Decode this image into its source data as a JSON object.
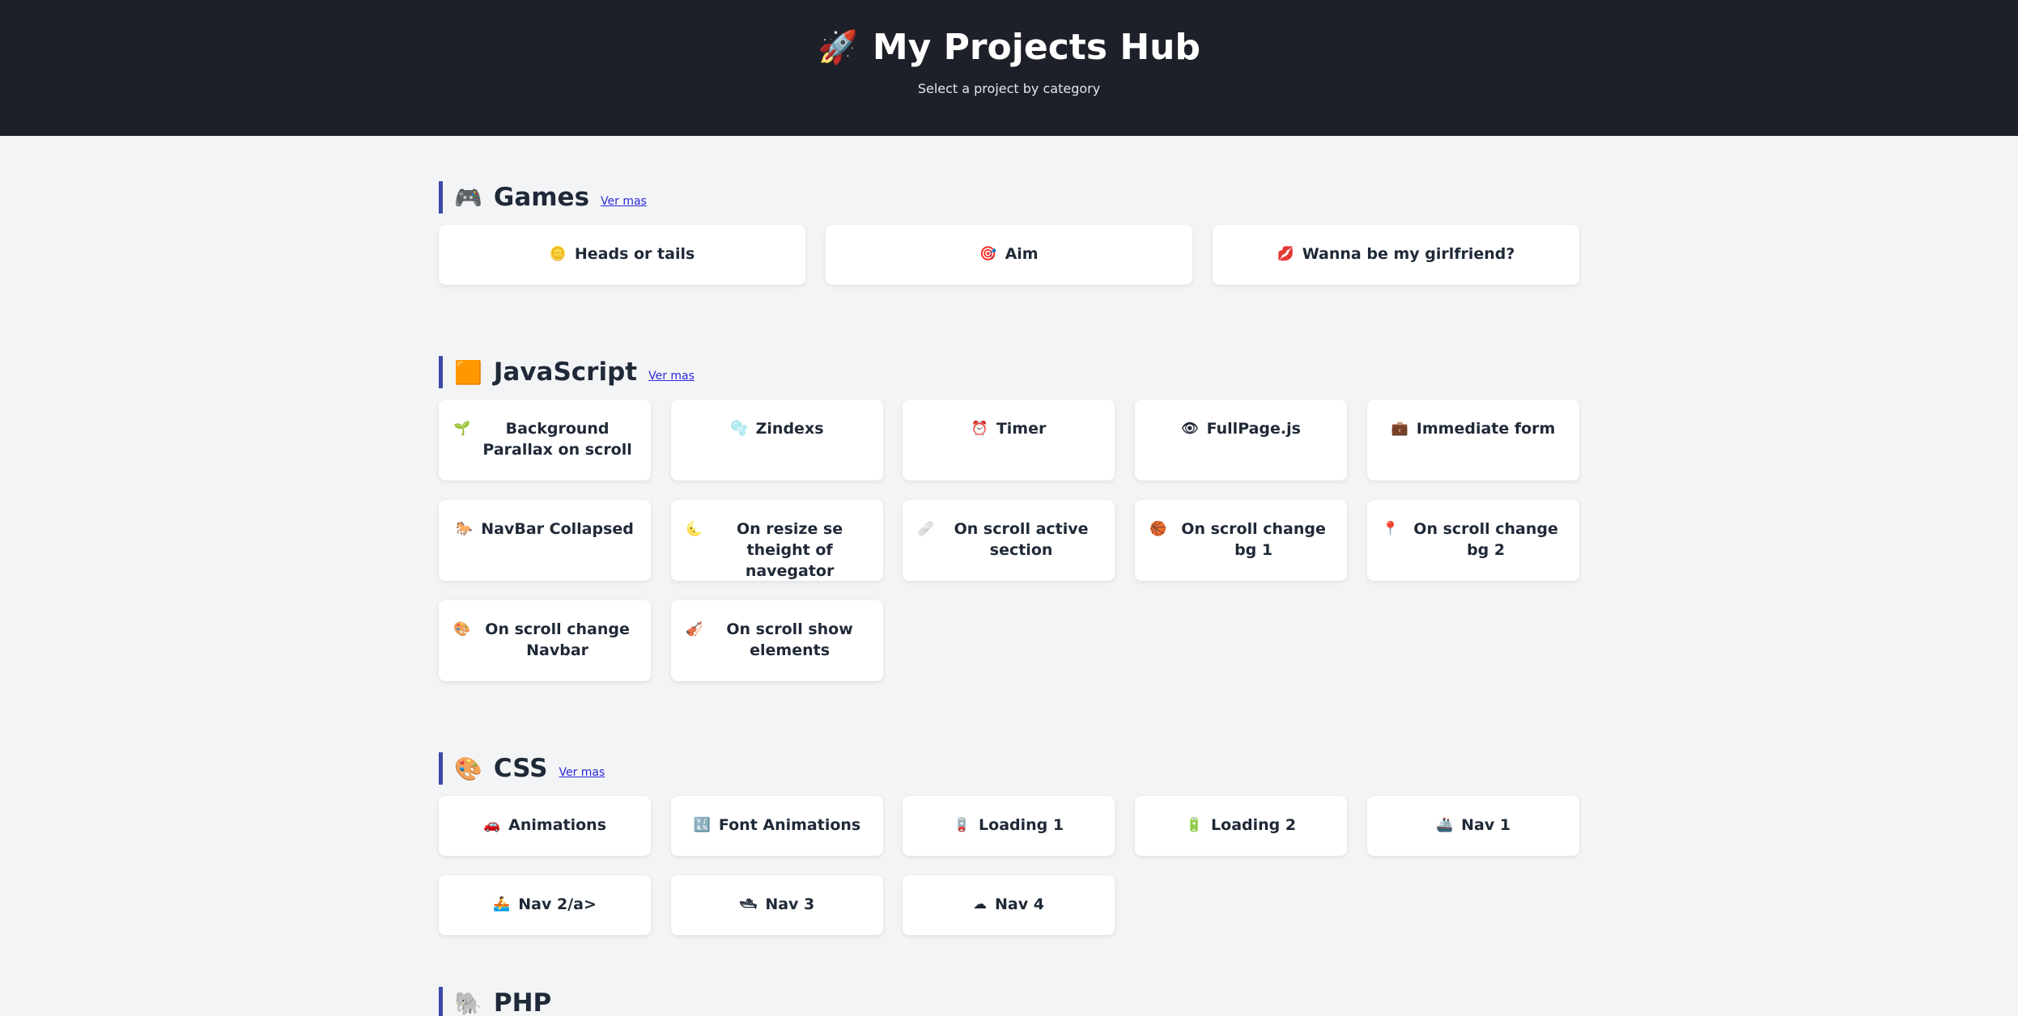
{
  "header": {
    "icon": "rocket-icon",
    "icon_glyph": "🚀",
    "title": "My Projects Hub",
    "subtitle": "Select a project by category"
  },
  "colors": {
    "header_bg": "#1e2029",
    "page_bg": "#f3f4f6",
    "accent_bar": "#3b4ba6",
    "link": "#2a2ad8"
  },
  "categories": [
    {
      "name": "Games",
      "icon": "gamepad-icon",
      "icon_glyph": "🎮",
      "link": "Ver mas",
      "items": [
        {
          "label": "Heads or tails",
          "icon": "coin-icon",
          "glyph": "🪙"
        },
        {
          "label": "Aim",
          "icon": "target-icon",
          "glyph": "🎯"
        },
        {
          "label": "Wanna be my girlfriend?",
          "icon": "lips-icon",
          "glyph": "💋"
        }
      ]
    },
    {
      "name": "JavaScript",
      "icon": "orange-square-icon",
      "icon_glyph": "🟧",
      "link": "Ver mas",
      "items": [
        {
          "label": "Background Parallax on scroll",
          "icon": "sprout-icon",
          "glyph": "🌱"
        },
        {
          "label": "Zindexs",
          "icon": "bubbles-icon",
          "glyph": "🫧"
        },
        {
          "label": "Timer",
          "icon": "alarm-icon",
          "glyph": "⏰"
        },
        {
          "label": "FullPage.js",
          "icon": "eye-icon",
          "glyph": "👁"
        },
        {
          "label": "Immediate form",
          "icon": "briefcase-icon",
          "glyph": "💼"
        },
        {
          "label": "NavBar Collapsed",
          "icon": "horse-icon",
          "glyph": "🐎"
        },
        {
          "label": "On resize se theight of navegator",
          "icon": "moon-icon",
          "glyph": "🌜"
        },
        {
          "label": "On scroll active section",
          "icon": "bandage-icon",
          "glyph": "🩹"
        },
        {
          "label": "On scroll change bg 1",
          "icon": "basketball-icon",
          "glyph": "🏀"
        },
        {
          "label": "On scroll change bg 2",
          "icon": "pin-icon",
          "glyph": "📍"
        },
        {
          "label": "On scroll change Navbar",
          "icon": "palette-icon",
          "glyph": "🎨"
        },
        {
          "label": "On scroll show elements",
          "icon": "violin-icon",
          "glyph": "🎻"
        }
      ]
    },
    {
      "name": "CSS",
      "icon": "palette-icon",
      "icon_glyph": "🎨",
      "link": "Ver mas",
      "items": [
        {
          "label": "Animations",
          "icon": "car-icon",
          "glyph": "🚗"
        },
        {
          "label": "Font Animations",
          "icon": "input-symbols-icon",
          "glyph": "🔣"
        },
        {
          "label": "Loading 1",
          "icon": "battery-icon",
          "glyph": "🪫"
        },
        {
          "label": "Loading 2",
          "icon": "battery-full-icon",
          "glyph": "🔋"
        },
        {
          "label": "Nav 1",
          "icon": "ship-icon",
          "glyph": "🚢"
        },
        {
          "label": "Nav 2/a>",
          "icon": "rower-icon",
          "glyph": "🚣"
        },
        {
          "label": "Nav 3",
          "icon": "boat-icon",
          "glyph": "🛥"
        },
        {
          "label": "Nav 4",
          "icon": "cloud-icon",
          "glyph": "☁"
        }
      ]
    },
    {
      "name": "PHP",
      "icon": "elephant-icon",
      "icon_glyph": "🐘",
      "link": "",
      "items": []
    }
  ]
}
